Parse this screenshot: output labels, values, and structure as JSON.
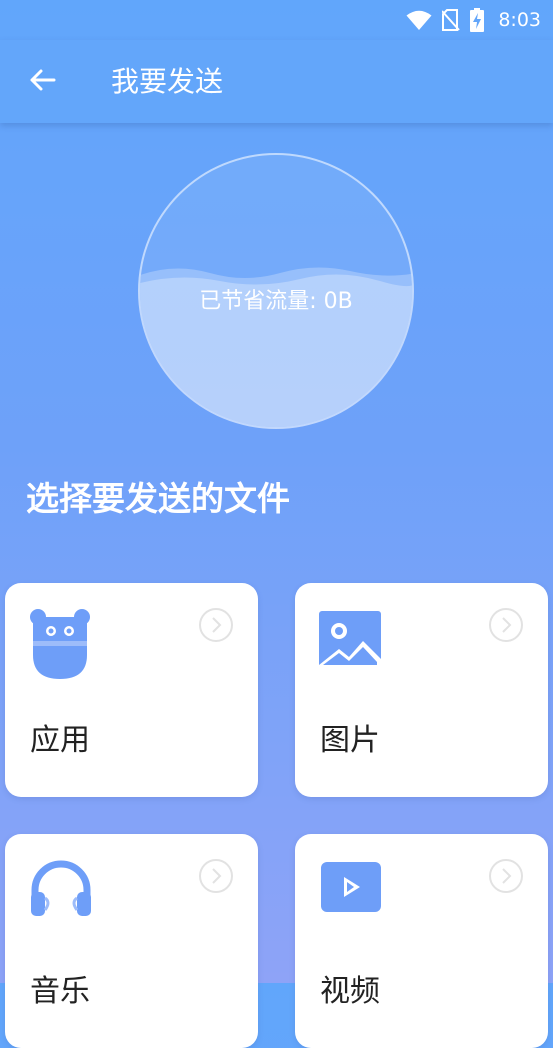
{
  "status": {
    "time": "8:03",
    "icons": [
      "wifi-icon",
      "no-sim-icon",
      "battery-charging-icon"
    ]
  },
  "header": {
    "title": "我要发送",
    "back_icon": "arrow-left-icon"
  },
  "saved": {
    "text": "已节省流量: 0B"
  },
  "section": {
    "title": "选择要发送的文件"
  },
  "categories": [
    {
      "label": "应用",
      "icon": "app-robot-icon"
    },
    {
      "label": "图片",
      "icon": "image-icon"
    },
    {
      "label": "音乐",
      "icon": "headphones-icon"
    },
    {
      "label": "视频",
      "icon": "video-play-icon"
    }
  ],
  "colors": {
    "accent": "#63a6fa",
    "icon_blue": "#6e9ef8"
  }
}
